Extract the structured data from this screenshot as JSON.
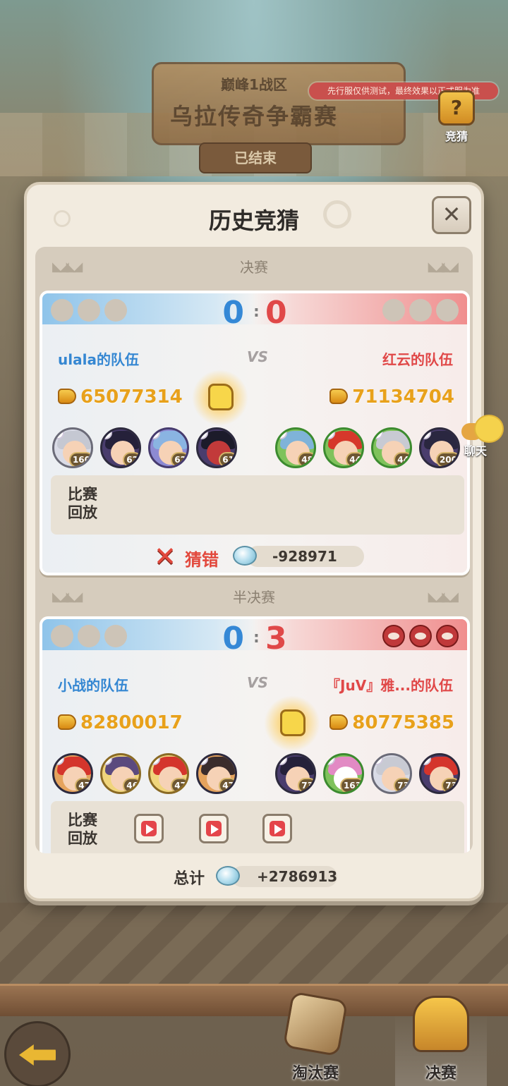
{
  "header": {
    "zone": "巅峰1战区",
    "event_title": "乌拉传奇争霸赛",
    "status": "已结束",
    "test_banner": "先行服仅供测试，最终效果以正式服为准",
    "guess_label": "竞猜"
  },
  "modal": {
    "title": "历史竞猜",
    "close_icon": "close-icon"
  },
  "matches": [
    {
      "round": "决赛",
      "score_left": "0",
      "score_right": "0",
      "team_left": "ulala的队伍",
      "team_right": "红云的队伍",
      "vs": "VS",
      "power_left": "65077314",
      "power_right": "71134704",
      "heroes_left": [
        "160",
        "62",
        "62",
        "61"
      ],
      "heroes_right": [
        "48",
        "44",
        "44",
        "200"
      ],
      "replay_label": "比赛\n回放",
      "result": "猜错",
      "amount": "-928971"
    },
    {
      "round": "半决赛",
      "score_left": "0",
      "score_right": "3",
      "team_left": "小战的队伍",
      "team_right": "『JuV』雅...的队伍",
      "vs": "VS",
      "power_left": "82800017",
      "power_right": "80775385",
      "heroes_left": [
        "47",
        "46",
        "47",
        "47"
      ],
      "heroes_right": [
        "73",
        "163",
        "73",
        "73"
      ],
      "replay_label": "比赛\n回放"
    }
  ],
  "total": {
    "label": "总计",
    "amount": "+2786913"
  },
  "chat": {
    "label": "聊天"
  },
  "bottom_nav": {
    "tabs": [
      {
        "label": "淘汰赛"
      },
      {
        "label": "决赛"
      }
    ]
  },
  "colors": {
    "blue_team": "#3488d6",
    "red_team": "#e04848",
    "power_gold": "#e8a11b"
  }
}
